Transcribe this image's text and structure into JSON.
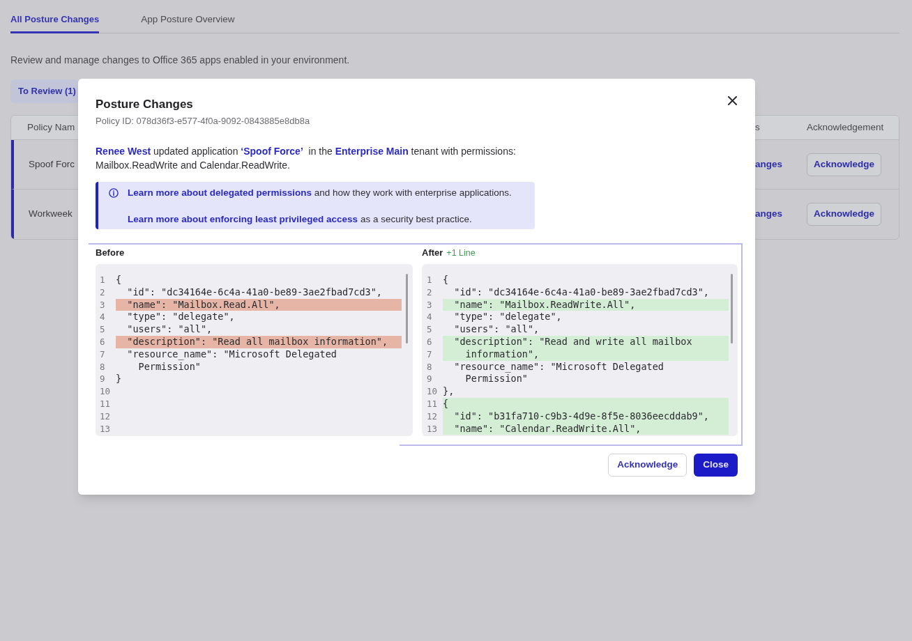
{
  "tabs": [
    {
      "label": "All Posture Changes",
      "selected": true
    },
    {
      "label": "App Posture Overview",
      "selected": false
    }
  ],
  "description": "Review and manage changes to Office 365 apps enabled in your environment.",
  "filter_tabs": [
    {
      "label": "To Review (1)",
      "selected": true
    }
  ],
  "table": {
    "columns": [
      "Policy Nam",
      "s",
      "Acknowledgement"
    ],
    "rows": [
      {
        "cells": [
          {
            "text": "Spoof Forc",
            "kind": "text"
          },
          {
            "text": "anges",
            "kind": "link"
          }
        ],
        "button": "Acknowledge"
      },
      {
        "cells": [
          {
            "text": "Workweek",
            "kind": "text"
          },
          {
            "text": "anges",
            "kind": "link"
          }
        ],
        "button": "Acknowledge"
      }
    ]
  },
  "modal": {
    "title": "Posture Changes",
    "policy_id": "Policy ID: 078d36f3-e577-4f0a-9092-0843885e8db8a",
    "summary": [
      {
        "text": "Renee West",
        "kind": "link"
      },
      {
        "text": " updated application ",
        "kind": "text"
      },
      {
        "text": "‘Spoof Force’",
        "kind": "link"
      },
      {
        "text": "  in the ",
        "kind": "text"
      },
      {
        "text": "Enterprise Main",
        "kind": "link"
      },
      {
        "text": " tenant with permissions: Mailbox.ReadWrite and Calendar.ReadWrite.",
        "kind": "text"
      }
    ],
    "info": {
      "paragraphs": [
        [
          {
            "text": "Learn more about delegated permissions",
            "kind": "link"
          },
          {
            "text": " and how they work with enterprise applications.",
            "kind": "text"
          }
        ],
        [
          {
            "text": "Learn more about enforcing least privileged access",
            "kind": "link"
          },
          {
            "text": " as a security best practice.",
            "kind": "text"
          }
        ]
      ]
    },
    "diff": {
      "before": {
        "label": "Before",
        "lines": [
          {
            "number": "1",
            "text": "{",
            "kind": "context"
          },
          {
            "number": "2",
            "text": "  \"id\": \"dc34164e-6c4a-41a0-be89-3ae2fbad7cd3\",",
            "kind": "context"
          },
          {
            "number": "3",
            "text": "  \"name\": \"Mailbox.Read.All\",",
            "kind": "removed"
          },
          {
            "number": "4",
            "text": "  \"type\": \"delegate\",",
            "kind": "context"
          },
          {
            "number": "5",
            "text": "  \"users\": \"all\",",
            "kind": "context"
          },
          {
            "number": "6",
            "text": "  \"description\": \"Read all mailbox information\",",
            "kind": "removed"
          },
          {
            "number": "7",
            "text": "  \"resource_name\": \"Microsoft Delegated",
            "kind": "context"
          },
          {
            "number": "8",
            "text": "    Permission\"",
            "kind": "context"
          },
          {
            "number": "9",
            "text": "}",
            "kind": "context"
          },
          {
            "number": "10",
            "kind": "context"
          },
          {
            "number": "11",
            "kind": "context"
          },
          {
            "number": "12",
            "kind": "context"
          },
          {
            "number": "13",
            "kind": "context"
          }
        ]
      },
      "after": {
        "label": "After",
        "note": "+1 Line",
        "lines": [
          {
            "number": "1",
            "text": "{",
            "kind": "context"
          },
          {
            "number": "2",
            "text": "  \"id\": \"dc34164e-6c4a-41a0-be89-3ae2fbad7cd3\",",
            "kind": "context"
          },
          {
            "number": "3",
            "text": "  \"name\": \"Mailbox.ReadWrite.All\",",
            "kind": "added"
          },
          {
            "number": "4",
            "text": "  \"type\": \"delegate\",",
            "kind": "context"
          },
          {
            "number": "5",
            "text": "  \"users\": \"all\",",
            "kind": "context"
          },
          {
            "number": "6",
            "text": "  \"description\": \"Read and write all mailbox",
            "kind": "added"
          },
          {
            "number": "7",
            "text": "    information\",",
            "kind": "added"
          },
          {
            "number": "8",
            "text": "  \"resource_name\": \"Microsoft Delegated",
            "kind": "context"
          },
          {
            "number": "9",
            "text": "    Permission\"",
            "kind": "context"
          },
          {
            "number": "10",
            "text": "},",
            "kind": "context"
          },
          {
            "number": "11",
            "text": "{",
            "kind": "added"
          },
          {
            "number": "12",
            "text": "  \"id\": \"b31fa710-c9b3-4d9e-8f5e-8036eecddab9\",",
            "kind": "added"
          },
          {
            "number": "13",
            "text": "  \"name\": \"Calendar.ReadWrite.All\",",
            "kind": "added"
          }
        ]
      }
    },
    "buttons": [
      {
        "label": "Acknowledge",
        "kind": "secondary"
      },
      {
        "label": "Close",
        "kind": "primary"
      }
    ]
  }
}
